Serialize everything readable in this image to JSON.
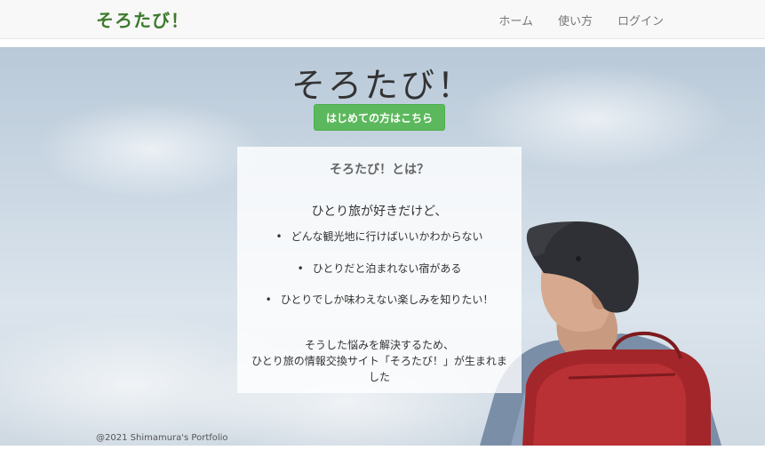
{
  "navbar": {
    "brand": "そろたび！",
    "links": [
      "ホーム",
      "使い方",
      "ログイン"
    ]
  },
  "hero": {
    "title": "そろたび！",
    "cta_label": "はじめての方はこちら"
  },
  "about": {
    "title": "そろたび！とは？",
    "lead": "ひとり旅が好きだけど、",
    "items": [
      "どんな観光地に行けばいいかわからない",
      "ひとりだと泊まれない宿がある",
      "ひとりでしか味わえない楽しみを知りたい！"
    ],
    "closing_line1": "そうした悩みを解決するため、",
    "closing_line2": "ひとり旅の情報交換サイト「そろたび！」が生まれました"
  },
  "footer": {
    "copyright": "@2021 Shimamura's Portfolio"
  },
  "colors": {
    "brand": "#3c7a2c",
    "cta": "#5cb85c",
    "navbar_bg": "#f8f8f8"
  }
}
